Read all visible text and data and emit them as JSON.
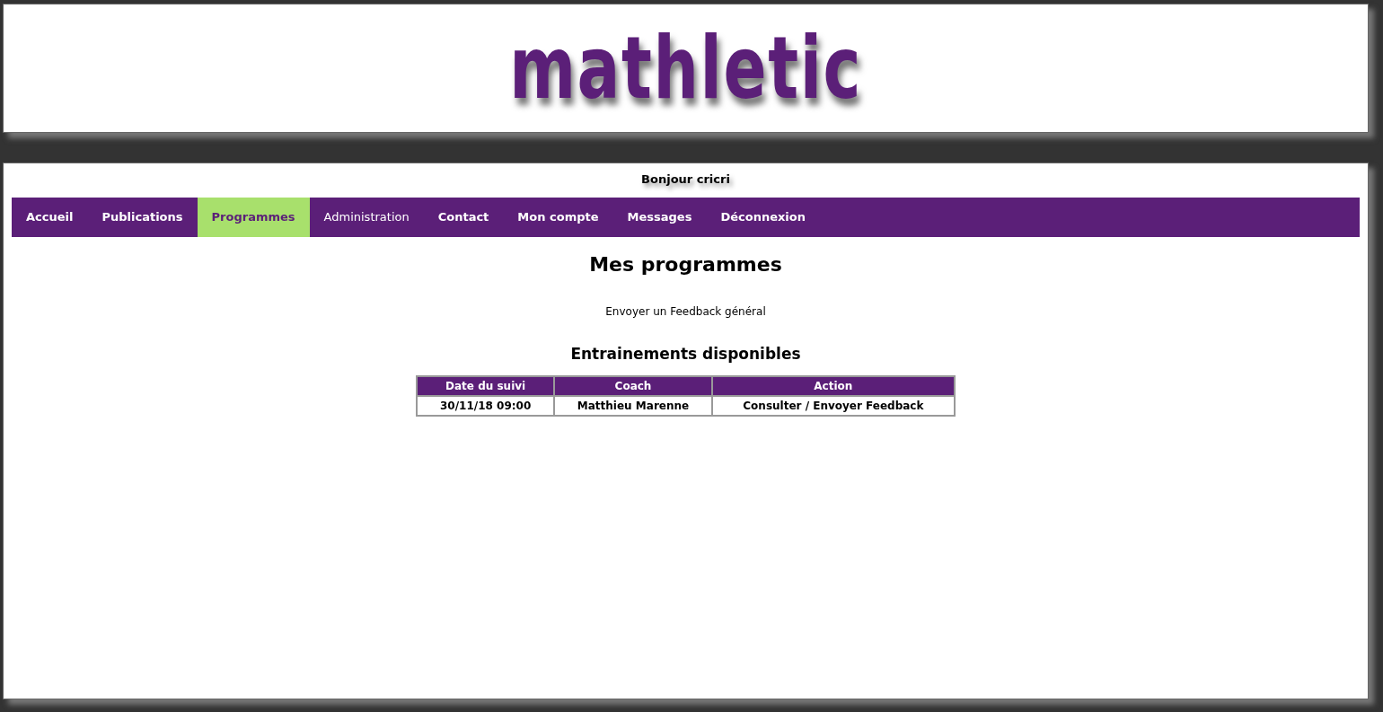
{
  "logo": "mathletic",
  "greeting": "Bonjour cricri",
  "nav": [
    {
      "label": "Accueil",
      "selected": false,
      "bold": true
    },
    {
      "label": "Publications",
      "selected": false,
      "bold": true
    },
    {
      "label": "Programmes",
      "selected": true,
      "bold": true
    },
    {
      "label": "Administration",
      "selected": false,
      "bold": false
    },
    {
      "label": "Contact",
      "selected": false,
      "bold": true
    },
    {
      "label": "Mon compte",
      "selected": false,
      "bold": true
    },
    {
      "label": "Messages",
      "selected": false,
      "bold": true
    },
    {
      "label": "Déconnexion",
      "selected": false,
      "bold": true
    }
  ],
  "title": "Mes programmes",
  "feedback_link": "Envoyer un Feedback général",
  "section_title": "Entrainements disponibles",
  "table": {
    "columns": [
      "Date du suivi",
      "Coach",
      "Action"
    ],
    "rows": [
      [
        "30/11/18 09:00",
        "Matthieu Marenne",
        "Consulter / Envoyer Feedback"
      ]
    ]
  }
}
